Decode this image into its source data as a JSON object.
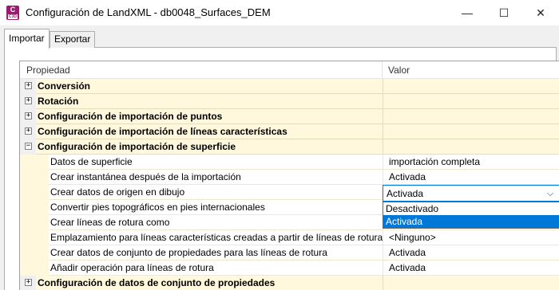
{
  "window": {
    "title": "Configuración de LandXML - db0048_Surfaces_DEM",
    "app_icon_letter": "C",
    "app_icon_sub": "C3D",
    "minimize_glyph": "—",
    "maximize_glyph": "☐",
    "close_glyph": "✕",
    "icons": [
      "civil3d-app-icon",
      "minimize-icon",
      "maximize-icon",
      "close-icon"
    ]
  },
  "tabs": [
    {
      "label": "Importar",
      "active": true
    },
    {
      "label": "Exportar",
      "active": false
    }
  ],
  "grid": {
    "header": {
      "property": "Propiedad",
      "value": "Valor"
    },
    "categories": [
      {
        "label": "Conversión",
        "expanded": false,
        "glyph": "+"
      },
      {
        "label": "Rotación",
        "expanded": false,
        "glyph": "+"
      },
      {
        "label": "Configuración de importación de puntos",
        "expanded": false,
        "glyph": "+"
      },
      {
        "label": "Configuración de importación de líneas características",
        "expanded": false,
        "glyph": "+"
      },
      {
        "label": "Configuración de importación de superficie",
        "expanded": true,
        "glyph": "−"
      },
      {
        "label": "Configuración de datos de conjunto de propiedades",
        "expanded": false,
        "glyph": "+"
      }
    ],
    "surface_properties": [
      {
        "label": "Datos de superficie",
        "value": "importación completa"
      },
      {
        "label": "Crear instantánea después de la importación",
        "value": "Activada"
      },
      {
        "label": "Crear datos de origen en dibujo",
        "value": "Activada"
      },
      {
        "label": "Convertir pies topográficos en pies internacionales",
        "value": ""
      },
      {
        "label": "Crear líneas de rotura como",
        "value": ""
      },
      {
        "label": "Emplazamiento para líneas características creadas a partir de líneas de rotura",
        "value": "<Ninguno>"
      },
      {
        "label": "Crear datos de conjunto de propiedades para las líneas de rotura",
        "value": "Activada"
      },
      {
        "label": "Añadir operación para líneas de rotura",
        "value": "Activada"
      }
    ]
  },
  "combo": {
    "selected": "Activada",
    "arrow_glyph": "⌵",
    "options": [
      "Desactivado",
      "Activada"
    ],
    "highlighted_option": "Activada"
  },
  "colors": {
    "category_background": "#fff8dc",
    "selection_blue": "#0078d7",
    "app_icon": "#9b1b6e"
  }
}
